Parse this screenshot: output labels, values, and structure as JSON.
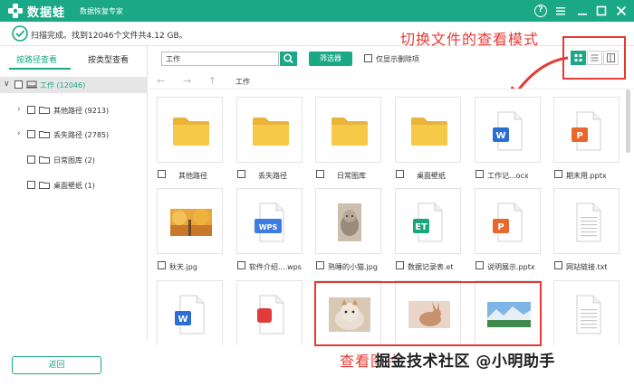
{
  "app": {
    "name": "数据蛙",
    "subtitle": "数据恢复专家"
  },
  "window_controls": {
    "help": "?"
  },
  "status": {
    "text": "扫描完成。找到12046个文件共4.12 GB。"
  },
  "annotations": {
    "switch_view": "切换文件的查看模式",
    "view_photos": "查看图片",
    "watermark": "掘金技术社区 @小明助手"
  },
  "sidebar": {
    "tabs": [
      {
        "label": "按路径查看"
      },
      {
        "label": "按类型查看"
      }
    ],
    "tree": [
      {
        "label": "工作 (12046)"
      },
      {
        "label": "其他路径 (9213)"
      },
      {
        "label": "丢失路径 (2785)"
      },
      {
        "label": "日常图库 (2)"
      },
      {
        "label": "桌面壁纸 (1)"
      }
    ],
    "back_button": "返回"
  },
  "toolbar": {
    "search_value": "工作",
    "filter_label": "筛选器",
    "show_deleted_label": "仅显示删除项"
  },
  "nav": {
    "path": "工作"
  },
  "files": [
    {
      "name": "其他路径",
      "kind": "folder"
    },
    {
      "name": "丢失路径",
      "kind": "folder"
    },
    {
      "name": "日常图库",
      "kind": "folder"
    },
    {
      "name": "桌面壁纸",
      "kind": "folder"
    },
    {
      "name": "工作记...ocx",
      "kind": "word",
      "badge": "W"
    },
    {
      "name": "期末用.pptx",
      "kind": "ppt",
      "badge": "P"
    },
    {
      "name": "秋天.jpg",
      "kind": "photo-autumn"
    },
    {
      "name": "软件介绍....wps",
      "kind": "wps",
      "badge": "WPS"
    },
    {
      "name": "熟睡的小猫.jpg",
      "kind": "photo-kitten"
    },
    {
      "name": "数据记录表.et",
      "kind": "et",
      "badge": "ET"
    },
    {
      "name": "说明展示.pptx",
      "kind": "ppt",
      "badge": "P"
    },
    {
      "name": "网站链接.txt",
      "kind": "txt"
    },
    {
      "name": "",
      "kind": "word",
      "badge": "W"
    },
    {
      "name": "",
      "kind": "pdf"
    },
    {
      "name": "",
      "kind": "photo-cat"
    },
    {
      "name": "",
      "kind": "photo-rabbit"
    },
    {
      "name": "",
      "kind": "photo-landscape"
    },
    {
      "name": "",
      "kind": "txt"
    }
  ],
  "colors": {
    "brand": "#1aa886",
    "annotation": "#e53935",
    "folder": "#f7c948",
    "word": "#2b6fd6",
    "ppt": "#e8672e",
    "wps": "#3d7ce0",
    "et": "#17a77a",
    "pdf": "#e03c3c"
  }
}
